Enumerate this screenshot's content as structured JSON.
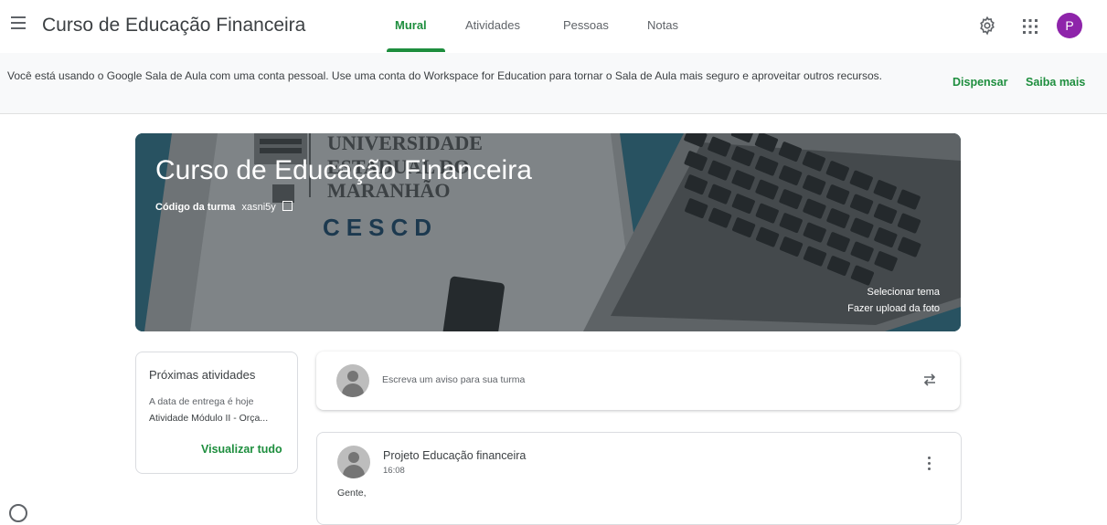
{
  "header": {
    "title": "Curso de Educação Financeira",
    "tabs": [
      {
        "label": "Mural"
      },
      {
        "label": "Atividades"
      },
      {
        "label": "Pessoas"
      },
      {
        "label": "Notas"
      }
    ],
    "avatar_letter": "P",
    "accent_color": "#1e8e3e",
    "avatar_color": "#8e24aa"
  },
  "banner": {
    "message": "Você está usando o Google Sala de Aula com uma conta pessoal. Use uma conta do Workspace for Education para tornar o Sala de Aula mais seguro e aproveitar outros recursos.",
    "dismiss_label": "Dispensar",
    "learn_more_label": "Saiba mais"
  },
  "hero": {
    "title": "Curso de Educação Financeira",
    "class_code_label": "Código da turma",
    "class_code": "xasni5y",
    "select_theme": "Selecionar tema",
    "upload_photo": "Fazer upload da foto",
    "bg_logo_line1": "UNIVERSIDADE",
    "bg_logo_line2": "ESTADUAL DO",
    "bg_logo_line3": "MARANHÃO",
    "bg_logo_acronym": "CESCD"
  },
  "upcoming": {
    "title": "Próximas atividades",
    "due_text": "A data de entrega é hoje",
    "activity": "Atividade Módulo II - Orça...",
    "view_all": "Visualizar tudo"
  },
  "announce": {
    "placeholder": "Escreva um aviso para sua turma"
  },
  "post": {
    "author": "Projeto Educação financeira",
    "time": "16:08",
    "body": "Gente,"
  }
}
